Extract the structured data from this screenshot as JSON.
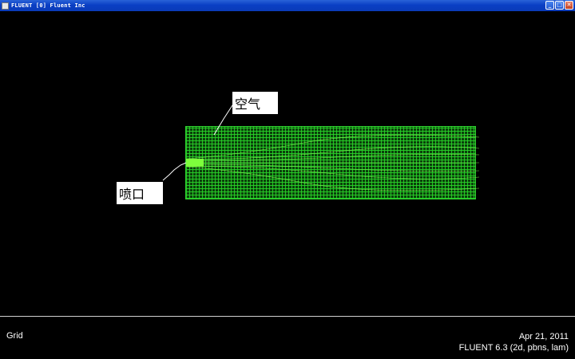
{
  "window": {
    "title": "FLUENT [0] Fluent Inc",
    "buttons": {
      "minimize": "_",
      "maximize": "□",
      "close": "✕"
    }
  },
  "graphics": {
    "annotations": {
      "air_label": "空气",
      "nozzle_label": "喷口"
    },
    "mesh_color": "#2fd42f",
    "background_color": "#000000"
  },
  "info_panel": {
    "display_name": "Grid",
    "date": "Apr 21, 2011",
    "version": "FLUENT 6.3 (2d, pbns, lam)"
  }
}
